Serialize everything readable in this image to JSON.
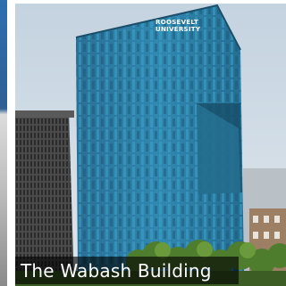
{
  "photo": {
    "description_icon": "tower-photo",
    "caption": "The Wabash Building",
    "sign_line_1": "ROOSEVELT",
    "sign_line_2": "UNIVERSITY"
  },
  "colors": {
    "sky": "#c9d6e2",
    "glass": "#2f7fa6",
    "glass_dark": "#1f5c7c",
    "side_building": "#3a3a3a",
    "caption_bg": "#000000"
  }
}
